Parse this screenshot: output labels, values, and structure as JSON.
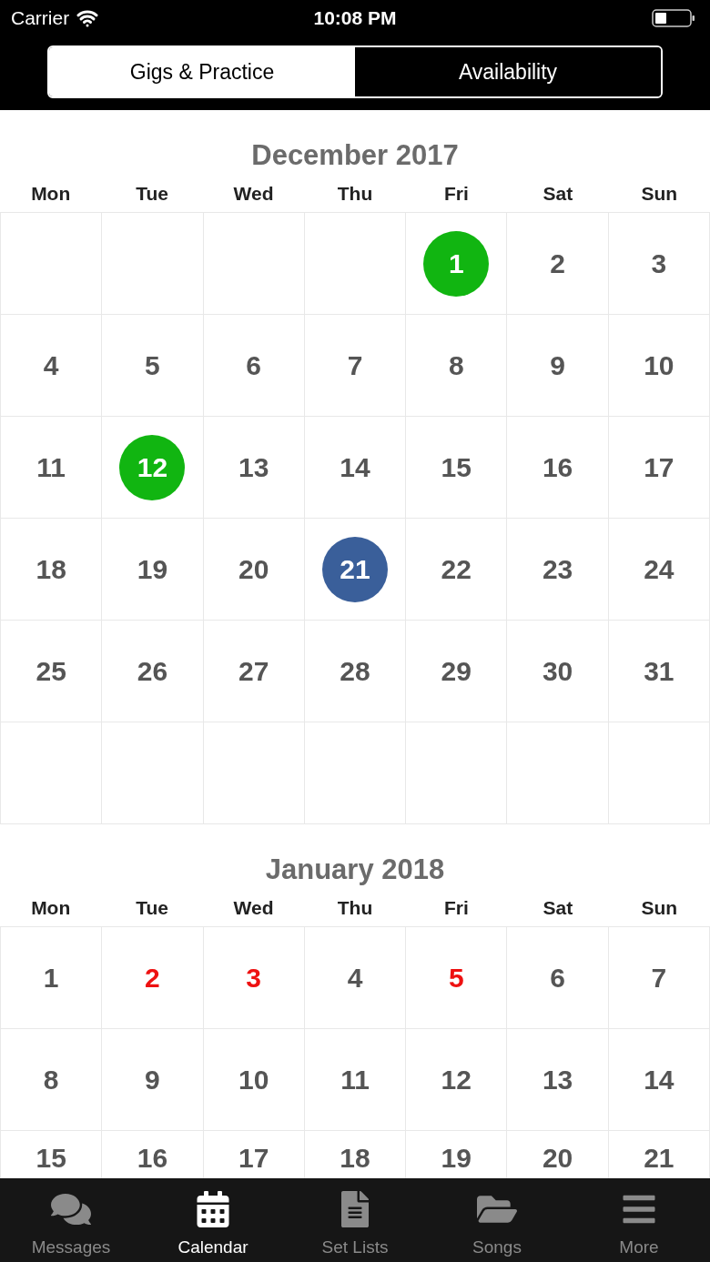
{
  "status_bar": {
    "carrier": "Carrier",
    "time": "10:08 PM"
  },
  "segments": [
    {
      "label": "Gigs & Practice",
      "selected": true
    },
    {
      "label": "Availability",
      "selected": false
    }
  ],
  "months": [
    {
      "title": "December 2017",
      "weekdays": [
        "Mon",
        "Tue",
        "Wed",
        "Thu",
        "Fri",
        "Sat",
        "Sun"
      ],
      "weeks": [
        [
          {
            "kind": "empty"
          },
          {
            "kind": "empty"
          },
          {
            "kind": "empty"
          },
          {
            "kind": "empty"
          },
          {
            "kind": "circle",
            "label": "1",
            "color": "#11b511"
          },
          {
            "kind": "plain",
            "label": "2"
          },
          {
            "kind": "plain",
            "label": "3"
          }
        ],
        [
          {
            "kind": "plain",
            "label": "4"
          },
          {
            "kind": "plain",
            "label": "5"
          },
          {
            "kind": "plain",
            "label": "6"
          },
          {
            "kind": "plain",
            "label": "7"
          },
          {
            "kind": "plain",
            "label": "8"
          },
          {
            "kind": "plain",
            "label": "9"
          },
          {
            "kind": "plain",
            "label": "10"
          }
        ],
        [
          {
            "kind": "plain",
            "label": "11"
          },
          {
            "kind": "circle",
            "label": "12",
            "color": "#11b511"
          },
          {
            "kind": "plain",
            "label": "13"
          },
          {
            "kind": "plain",
            "label": "14"
          },
          {
            "kind": "plain",
            "label": "15"
          },
          {
            "kind": "plain",
            "label": "16"
          },
          {
            "kind": "plain",
            "label": "17"
          }
        ],
        [
          {
            "kind": "plain",
            "label": "18"
          },
          {
            "kind": "plain",
            "label": "19"
          },
          {
            "kind": "plain",
            "label": "20"
          },
          {
            "kind": "circle",
            "label": "21",
            "color": "#3a5f9a"
          },
          {
            "kind": "plain",
            "label": "22"
          },
          {
            "kind": "plain",
            "label": "23"
          },
          {
            "kind": "plain",
            "label": "24"
          }
        ],
        [
          {
            "kind": "plain",
            "label": "25"
          },
          {
            "kind": "plain",
            "label": "26"
          },
          {
            "kind": "plain",
            "label": "27"
          },
          {
            "kind": "plain",
            "label": "28"
          },
          {
            "kind": "plain",
            "label": "29"
          },
          {
            "kind": "plain",
            "label": "30"
          },
          {
            "kind": "plain",
            "label": "31"
          }
        ],
        [
          {
            "kind": "empty"
          },
          {
            "kind": "empty"
          },
          {
            "kind": "empty"
          },
          {
            "kind": "empty"
          },
          {
            "kind": "empty"
          },
          {
            "kind": "empty"
          },
          {
            "kind": "empty"
          }
        ]
      ]
    },
    {
      "title": "January 2018",
      "weekdays": [
        "Mon",
        "Tue",
        "Wed",
        "Thu",
        "Fri",
        "Sat",
        "Sun"
      ],
      "weeks": [
        [
          {
            "kind": "plain",
            "label": "1"
          },
          {
            "kind": "alert",
            "label": "2",
            "color": "#ee1111"
          },
          {
            "kind": "alert",
            "label": "3",
            "color": "#ee1111"
          },
          {
            "kind": "plain",
            "label": "4"
          },
          {
            "kind": "alert",
            "label": "5",
            "color": "#ee1111"
          },
          {
            "kind": "plain",
            "label": "6"
          },
          {
            "kind": "plain",
            "label": "7"
          }
        ],
        [
          {
            "kind": "plain",
            "label": "8"
          },
          {
            "kind": "plain",
            "label": "9"
          },
          {
            "kind": "plain",
            "label": "10"
          },
          {
            "kind": "plain",
            "label": "11"
          },
          {
            "kind": "plain",
            "label": "12"
          },
          {
            "kind": "plain",
            "label": "13"
          },
          {
            "kind": "plain",
            "label": "14"
          }
        ],
        [
          {
            "kind": "plain",
            "label": "15"
          },
          {
            "kind": "plain",
            "label": "16"
          },
          {
            "kind": "plain",
            "label": "17"
          },
          {
            "kind": "plain",
            "label": "18"
          },
          {
            "kind": "plain",
            "label": "19"
          },
          {
            "kind": "plain",
            "label": "20"
          },
          {
            "kind": "plain",
            "label": "21"
          }
        ]
      ]
    }
  ],
  "tab_bar": [
    {
      "kind": "messages",
      "label": "Messages",
      "selected": false
    },
    {
      "kind": "calendar",
      "label": "Calendar",
      "selected": true
    },
    {
      "kind": "setlists",
      "label": "Set Lists",
      "selected": false
    },
    {
      "kind": "songs",
      "label": "Songs",
      "selected": false
    },
    {
      "kind": "more",
      "label": "More",
      "selected": false
    }
  ]
}
